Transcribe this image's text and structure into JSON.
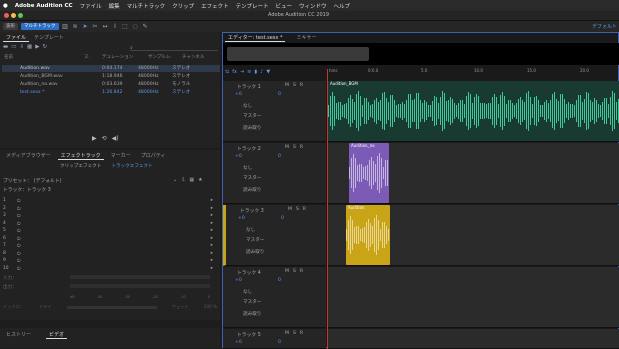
{
  "menubar": {
    "app": "Adobe Audition CC",
    "items": [
      "ファイル",
      "編集",
      "マルチトラック",
      "クリップ",
      "エフェクト",
      "テンプレート",
      "ビュー",
      "ウィンドウ",
      "ヘルプ"
    ]
  },
  "title": "Adobe Audition CC 2019",
  "toolbar": {
    "waveform": "波形",
    "multitrack": "マルチトラック",
    "workspace": "デフォルト"
  },
  "files": {
    "tabs": [
      "ファイル",
      "テンプレート"
    ],
    "headers": [
      "名前",
      "ス.",
      "デュレーション",
      "サンプルレ.",
      "チャンネル"
    ],
    "rows": [
      {
        "name": "Audition.wav",
        "dur": "0:04.174",
        "rate": "48000Hz",
        "ch": "ステレオ"
      },
      {
        "name": "Audition_BGM.wav",
        "dur": "1:18.946",
        "rate": "48000Hz",
        "ch": "ステレオ"
      },
      {
        "name": "Audition_no.wav",
        "dur": "0:03.639",
        "rate": "48000Hz",
        "ch": "モノラル"
      },
      {
        "name": "test.sesx *",
        "dur": "1:26.842",
        "rate": "48000Hz",
        "ch": "ステレオ"
      }
    ]
  },
  "effects": {
    "tabs": [
      "メディアブラウザー",
      "エフェクトラック",
      "マーカー",
      "プロパティ"
    ],
    "subtabs": [
      "クリップエフェクト",
      "トラックエフェクト"
    ],
    "preset_label": "プリセット：",
    "preset_value": "(デフォルト)",
    "track_label": "トラック：トラック 3",
    "slots": [
      "1",
      "2",
      "3",
      "4",
      "5",
      "6",
      "7",
      "8",
      "9",
      "10"
    ],
    "input_label": "入力：",
    "output_label": "出力：",
    "db": [
      "dB",
      "-40",
      "-30",
      "-20",
      "-10",
      "0"
    ],
    "mix_label": "ミックス：",
    "dry": "ドライ",
    "wet": "ウェット",
    "mix_value": "100 %"
  },
  "bottom": {
    "tabs": [
      "ヒストリー",
      "ビデオ"
    ]
  },
  "editor": {
    "tabs": [
      "エディター: test.sesx *",
      "ミキサー"
    ],
    "ruler": [
      "hms",
      "0:0.0",
      "5.0",
      "10.0",
      "15.0",
      "20.0",
      "25.0"
    ],
    "tracks": [
      {
        "name": "トラック 1",
        "vol": "+0",
        "pan": "0",
        "input": "なし",
        "output": "マスター",
        "mode": "読み取り"
      },
      {
        "name": "トラック 2",
        "vol": "+0",
        "pan": "0",
        "input": "なし",
        "output": "マスター",
        "mode": "読み取り"
      },
      {
        "name": "トラック 3",
        "vol": "+0",
        "pan": "0",
        "input": "なし",
        "output": "マスター",
        "mode": "読み取り"
      },
      {
        "name": "トラック 4",
        "vol": "+0",
        "pan": "0",
        "input": "なし",
        "output": "マスター",
        "mode": "読み取り"
      },
      {
        "name": "トラック 5",
        "vol": "+0",
        "pan": "0",
        "input": "",
        "output": "",
        "mode": ""
      }
    ],
    "clips": [
      {
        "label": "Audition_BGM",
        "color": "#2b8f6e"
      },
      {
        "label": "Audition_no",
        "color": "#7b5bb5"
      },
      {
        "label": "Audition",
        "color": "#c9a417"
      }
    ],
    "msr": [
      "M",
      "S",
      "R"
    ]
  },
  "colors": {
    "accent": "#2d6fc7",
    "track3": "#c9a417"
  }
}
